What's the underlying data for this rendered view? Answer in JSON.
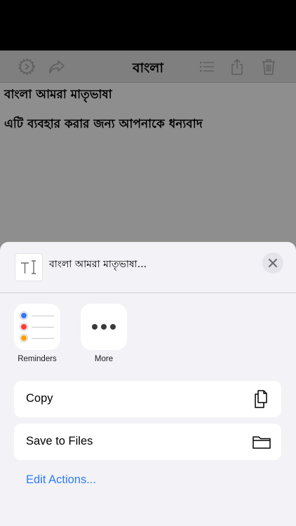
{
  "toolbar": {
    "title": "বাংলা",
    "icons": [
      "gear-icon",
      "share-arrow-icon",
      "list-icon",
      "export-icon",
      "trash-icon"
    ]
  },
  "document": {
    "lines": [
      "বাংলা আমরা মাতৃভাষা",
      "এটি ব্যবহার করার জন্য আপনাকে ধন্যবাদ"
    ]
  },
  "share_sheet": {
    "preview_title": "বাংলা আমরা মাতৃভাষা...",
    "apps": [
      {
        "label": "Reminders",
        "icon": "reminders-icon"
      },
      {
        "label": "More",
        "icon": "more-icon"
      }
    ],
    "actions": [
      {
        "label": "Copy",
        "icon": "copy-icon"
      },
      {
        "label": "Save to Files",
        "icon": "folder-icon"
      }
    ],
    "edit_actions_label": "Edit Actions..."
  },
  "colors": {
    "accent": "#2f7cf6",
    "reminder_blue": "#3478f6",
    "reminder_red": "#ff3b30",
    "reminder_orange": "#ff9f0a"
  }
}
